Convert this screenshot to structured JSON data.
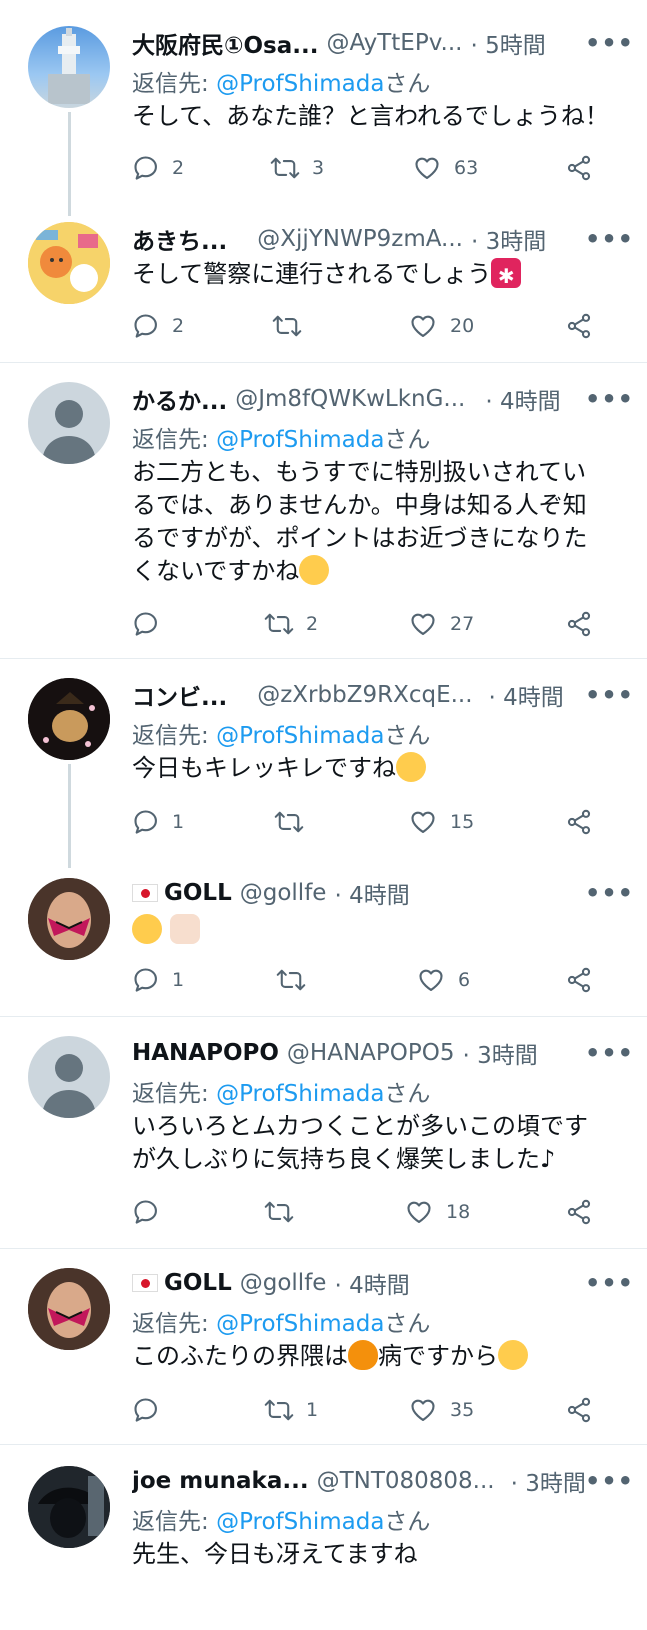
{
  "ui": {
    "reply_prefix": "返信先: ",
    "reply_suffix": "さん",
    "more": "•••"
  },
  "tweets": [
    {
      "name": "大阪府民①Osa...",
      "handle": "@AyTtEPv...",
      "time": "· 5時間",
      "reply_to": "@ProfShimada",
      "text": "そして、あなた誰？と言われるでしょうね！",
      "replies": "2",
      "retweets": "3",
      "likes": "63",
      "avatar_icon": "tsutenkaku-tower-photo"
    },
    {
      "name": "あきち...",
      "handle": "@XjjYNWP9zmA...",
      "time": "· 3時間",
      "text": "そして警察に連行されるでしょう",
      "emoji_icon": "police-siren-emoji",
      "replies": "2",
      "retweets": "",
      "likes": "20",
      "avatar_icon": "cartoon-cat-illustration"
    },
    {
      "name": "かるか...",
      "handle": "@Jm8fQWKwLknG...",
      "time": "· 4時間",
      "reply_to": "@ProfShimada",
      "text": "お二方とも、もうすでに特別扱いされているでは、ありませんか。中身は知る人ぞ知るですがが、ポイントはお近づきになりたくないですかね",
      "emoji_icon": "screaming-face-emoji",
      "replies": "",
      "retweets": "2",
      "likes": "27",
      "avatar_icon": "default-profile-silhouette"
    },
    {
      "name": "コンビ...",
      "handle": "@zXrbbZ9RXcqE...",
      "time": "· 4時間",
      "reply_to": "@ProfShimada",
      "text": "今日もキレッキレですね",
      "emoji_icon": "tears-of-joy-emoji",
      "replies": "1",
      "retweets": "",
      "likes": "15",
      "avatar_icon": "samurai-dog-photo"
    },
    {
      "name": "GOLL",
      "handle": "@gollfe",
      "time": "· 4時間",
      "text": "",
      "emoji_icon": "tears-of-joy-thumbs-up-emoji",
      "replies": "1",
      "retweets": "",
      "likes": "6",
      "avatar_icon": "butterfly-mask-woman-photo"
    },
    {
      "name": "HANAPOPO",
      "handle": "@HANAPOPO5",
      "time": "· 3時間",
      "reply_to": "@ProfShimada",
      "text": "いろいろとムカつくことが多いこの頃ですが久しぶりに気持ち良く爆笑しました♪",
      "replies": "",
      "retweets": "",
      "likes": "18",
      "avatar_icon": "default-profile-silhouette"
    },
    {
      "name": "GOLL",
      "handle": "@gollfe",
      "time": "· 4時間",
      "reply_to": "@ProfShimada",
      "text_a": "このふたりの界隈は",
      "text_b": "病ですから",
      "emoji_icon": "fire-emoji",
      "replies": "",
      "retweets": "1",
      "likes": "35",
      "avatar_icon": "butterfly-mask-woman-photo"
    },
    {
      "name": "joe munaka...",
      "handle": "@TNT080808...",
      "time": "· 3時間",
      "reply_to": "@ProfShimada",
      "text": "先生、今日も冴えてますね",
      "avatar_icon": "dark-silhouette-photo"
    }
  ]
}
